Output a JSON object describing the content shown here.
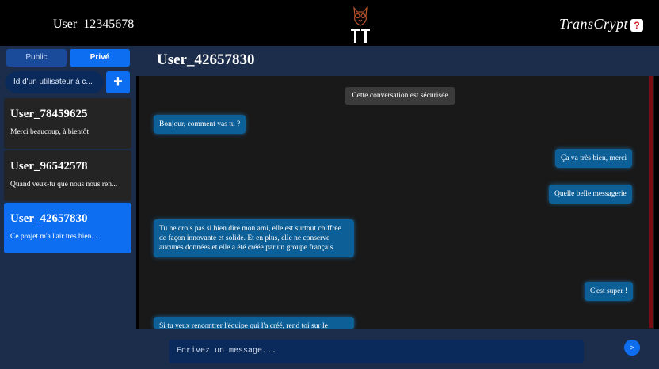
{
  "header": {
    "user": "User_12345678",
    "brand": "TransCrypt",
    "help_label": "?"
  },
  "sidebar": {
    "tabs": [
      {
        "label": "Public"
      },
      {
        "label": "Privé"
      }
    ],
    "search_placeholder": "Id d'un utilisateur à c...",
    "add_label": "+",
    "conversations": [
      {
        "name": "User_78459625",
        "preview": "Merci beaucoup, à bientôt"
      },
      {
        "name": "User_96542578",
        "preview": "Quand veux-tu que nous nous ren..."
      },
      {
        "name": "User_42657830",
        "preview": "Ce projet m'a l'air tres bien..."
      }
    ]
  },
  "chat": {
    "title": "User_42657830",
    "system_notice": "Cette conversation est sécurisée",
    "messages": [
      {
        "text": "Bonjour, comment vas tu ?"
      },
      {
        "text": "Ça va très bien, merci"
      },
      {
        "text": "Quelle belle messagerie"
      },
      {
        "text": "Tu ne crois pas si bien dire mon ami, elle est surtout chiffrée de façon innovante et solide. Et en plus, elle ne conserve aucunes données et elle a été créée par un groupe français."
      },
      {
        "text": "C'est super !"
      },
      {
        "text": "Si tu veux rencontrer l'équipe qui l'a créé, rend toi sur le"
      }
    ],
    "composer_placeholder": "Ecrivez un message...",
    "send_label": ">"
  },
  "colors": {
    "accent": "#0d6ef2",
    "bubble": "#0d5f97",
    "panel": "#1b2d4a",
    "scroll_thumb": "#7a0b10"
  }
}
